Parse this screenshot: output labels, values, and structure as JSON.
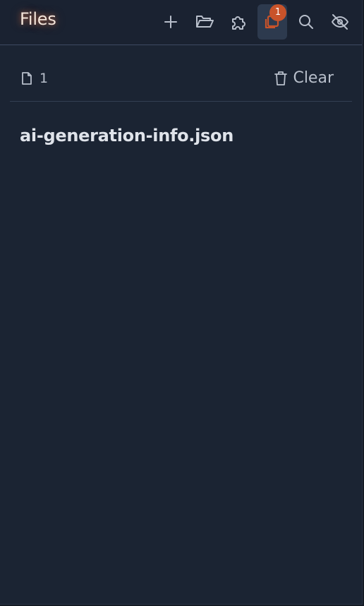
{
  "header": {
    "title": "Files",
    "icons": [
      "plus-icon",
      "folder-open-icon",
      "puzzle-icon",
      "stack-icon",
      "search-icon",
      "eye-off-icon"
    ],
    "badge_count": "1",
    "accent": "#c8532a"
  },
  "info": {
    "file_count": "1",
    "clear_label": "Clear"
  },
  "files": [
    {
      "name": "ai-generation-info.json"
    }
  ]
}
